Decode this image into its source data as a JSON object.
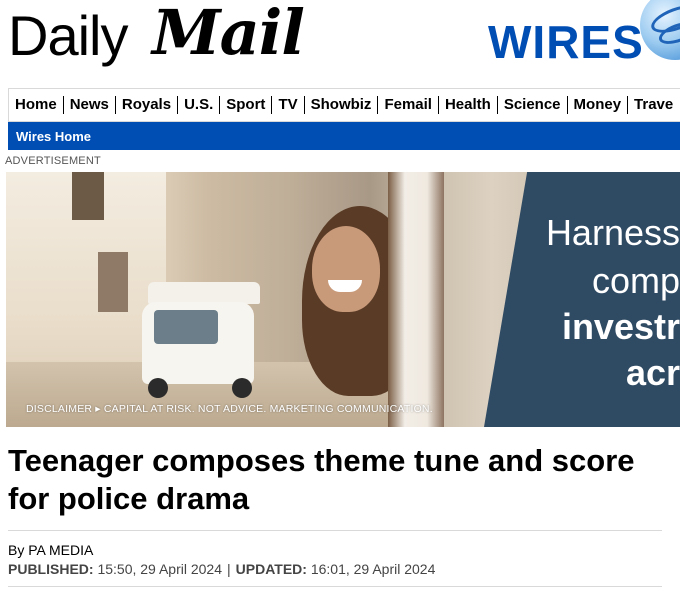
{
  "brand": {
    "daily": "Daily",
    "mail": "Mail",
    "wires": "WIRES",
    "accent_color": "#004db3"
  },
  "nav": {
    "items": [
      "Home",
      "News",
      "Royals",
      "U.S.",
      "Sport",
      "TV",
      "Showbiz",
      "Femail",
      "Health",
      "Science",
      "Money",
      "Trave"
    ]
  },
  "subnav": {
    "wires_home": "Wires Home"
  },
  "advert": {
    "label": "ADVERTISEMENT",
    "lines": [
      "Harness",
      "comp",
      "investr",
      "acr"
    ],
    "disclaimer": "DISCLAIMER ▸ CAPITAL AT RISK. NOT ADVICE. MARKETING COMMUNICATION."
  },
  "article": {
    "headline": "Teenager composes theme tune and score for police drama",
    "byline": "By PA MEDIA",
    "published_label": "PUBLISHED:",
    "published": "15:50, 29 April 2024",
    "updated_label": "UPDATED:",
    "updated": "16:01, 29 April 2024"
  }
}
